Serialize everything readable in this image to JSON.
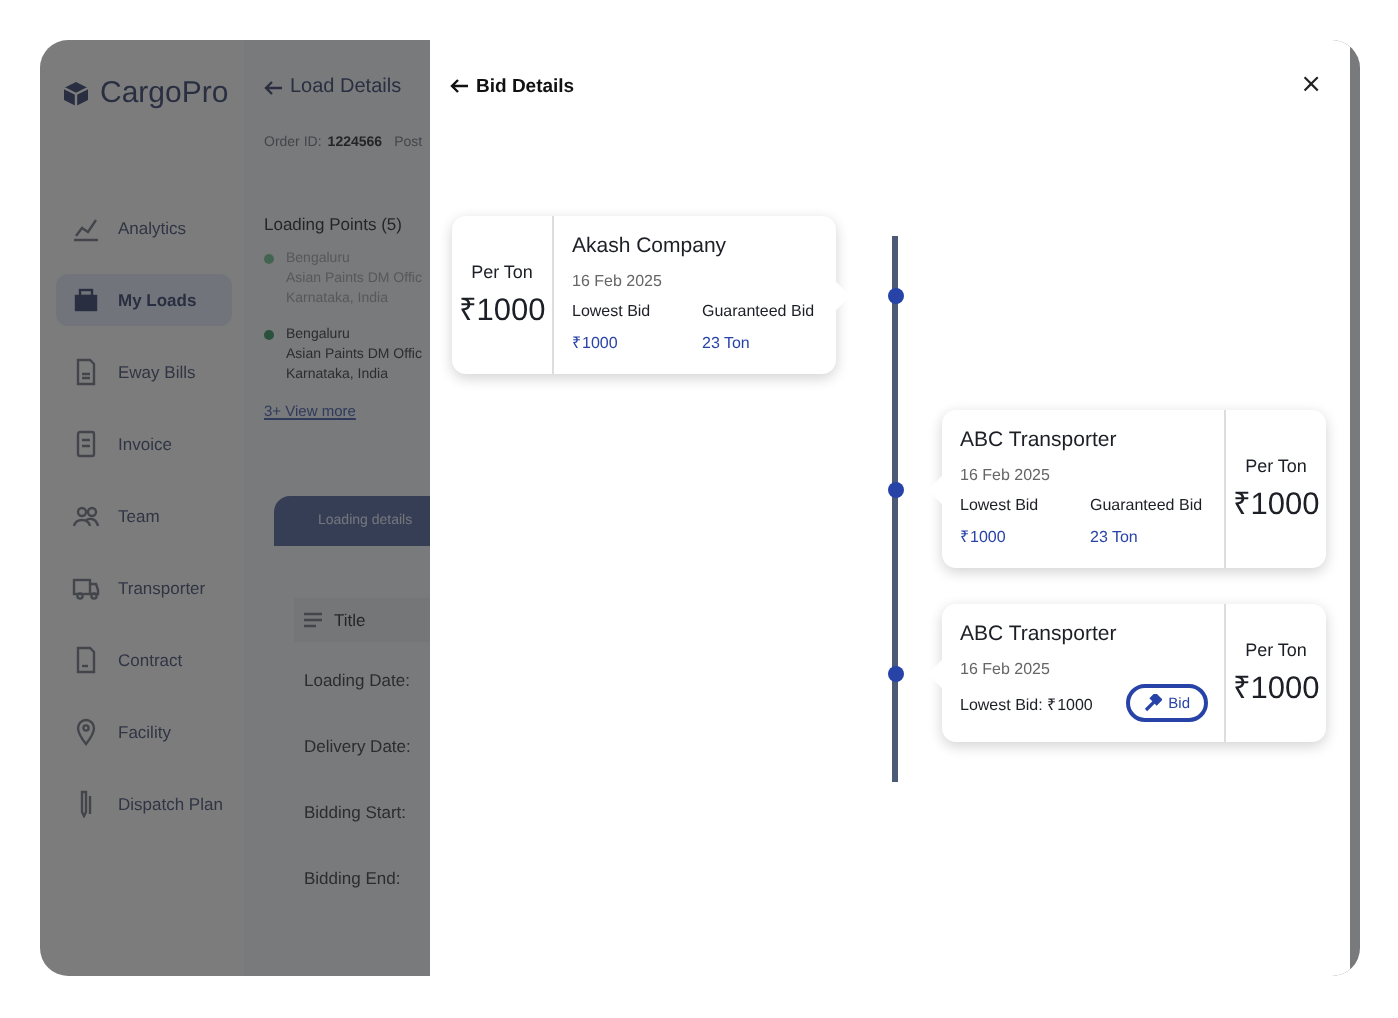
{
  "app": {
    "logo": "CargoPro",
    "sidebar": {
      "items": [
        {
          "label": "Analytics",
          "selected": false
        },
        {
          "label": "My Loads",
          "selected": true
        },
        {
          "label": "Eway Bills",
          "selected": false
        },
        {
          "label": "Invoice",
          "selected": false
        },
        {
          "label": "Team",
          "selected": false
        },
        {
          "label": "Transporter",
          "selected": false
        },
        {
          "label": "Contract",
          "selected": false
        },
        {
          "label": "Facility",
          "selected": false
        },
        {
          "label": "Dispatch Plan",
          "selected": false
        }
      ]
    },
    "header": {
      "title": "Load Details"
    },
    "order": {
      "label": "Order ID:",
      "value": "1224566",
      "next_label": "Post"
    },
    "loading_points": {
      "title": "Loading Points (5)",
      "items": [
        {
          "city": "Bengaluru",
          "name": "Asian Paints DM Offic",
          "region": "Karnataka, India",
          "muted": true
        },
        {
          "city": "Bengaluru",
          "name": "Asian Paints DM Offic",
          "region": "Karnataka, India",
          "muted": false
        }
      ],
      "more": "3+ View more"
    },
    "tabs": [
      {
        "label": "Loading details",
        "selected": true
      }
    ],
    "details": {
      "header": "Title",
      "rows": [
        "Loading Date:",
        "Delivery Date:",
        "Bidding Start:",
        "Bidding End:"
      ]
    }
  },
  "drawer": {
    "title": "Bid Details",
    "close": "×",
    "bids": [
      {
        "kind": "quote",
        "on_left": true,
        "company": "Akash Company",
        "date": "16 Feb 2025",
        "rate_label": "Per Ton",
        "rate": "₹1000",
        "stats": [
          {
            "label": "Lowest Bid",
            "value": "₹1000"
          },
          {
            "label": "Guaranteed Bid",
            "value": "23 Ton"
          }
        ]
      },
      {
        "kind": "quote",
        "on_left": false,
        "company": "ABC Transporter",
        "date": "16 Feb 2025",
        "rate_label": "Per Ton",
        "rate": "₹1000",
        "stats": [
          {
            "label": "Lowest Bid",
            "value": "₹1000"
          },
          {
            "label": "Guaranteed Bid",
            "value": "23 Ton"
          }
        ]
      },
      {
        "kind": "open",
        "on_left": false,
        "company": "ABC Transporter",
        "date": "16 Feb 2025",
        "rate_label": "Per Ton",
        "rate": "₹1000",
        "lowest": "Lowest Bid: ₹1000",
        "button": "Bid"
      }
    ]
  }
}
